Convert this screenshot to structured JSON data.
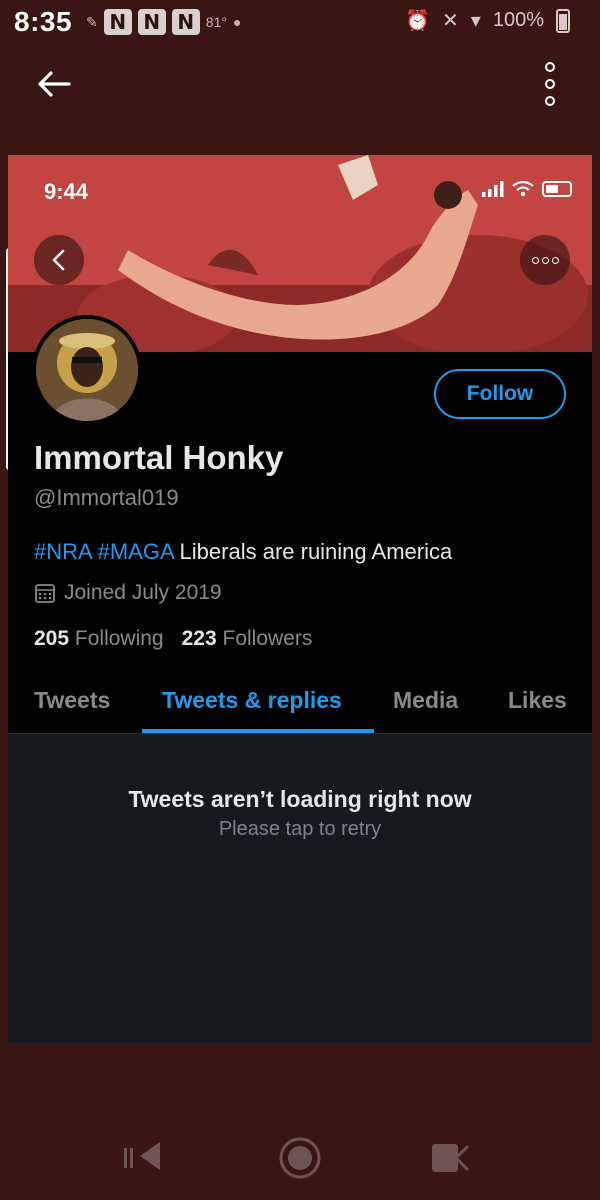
{
  "status_bar": {
    "time": "8:35",
    "small_text": "81°",
    "battery_text": "100%"
  },
  "profile": {
    "inner_time": "9:44",
    "name": "Immortal Honky",
    "handle": "@Immortal019",
    "bio_hashtags": [
      "#NRA",
      "#MAGA"
    ],
    "bio_text": "Liberals are ruining America",
    "joined": "Joined July 2019",
    "following_count": "205",
    "following_label": "Following",
    "followers_count": "223",
    "followers_label": "Followers",
    "follow_label": "Follow"
  },
  "tabs": [
    {
      "label": "Tweets",
      "active": false
    },
    {
      "label": "Tweets & replies",
      "active": true
    },
    {
      "label": "Media",
      "active": false
    },
    {
      "label": "Likes",
      "active": false
    }
  ],
  "feed": {
    "error_title": "Tweets aren’t loading right now",
    "error_sub": "Please tap to retry"
  },
  "icons": {
    "back": "arrow-left-icon",
    "overflow": "more-vertical-icon",
    "calendar": "calendar-icon"
  },
  "colors": {
    "background": "#3a1613",
    "accent": "#1d9bf0",
    "screen_bg": "#000000",
    "feed_bg": "#15181c"
  }
}
